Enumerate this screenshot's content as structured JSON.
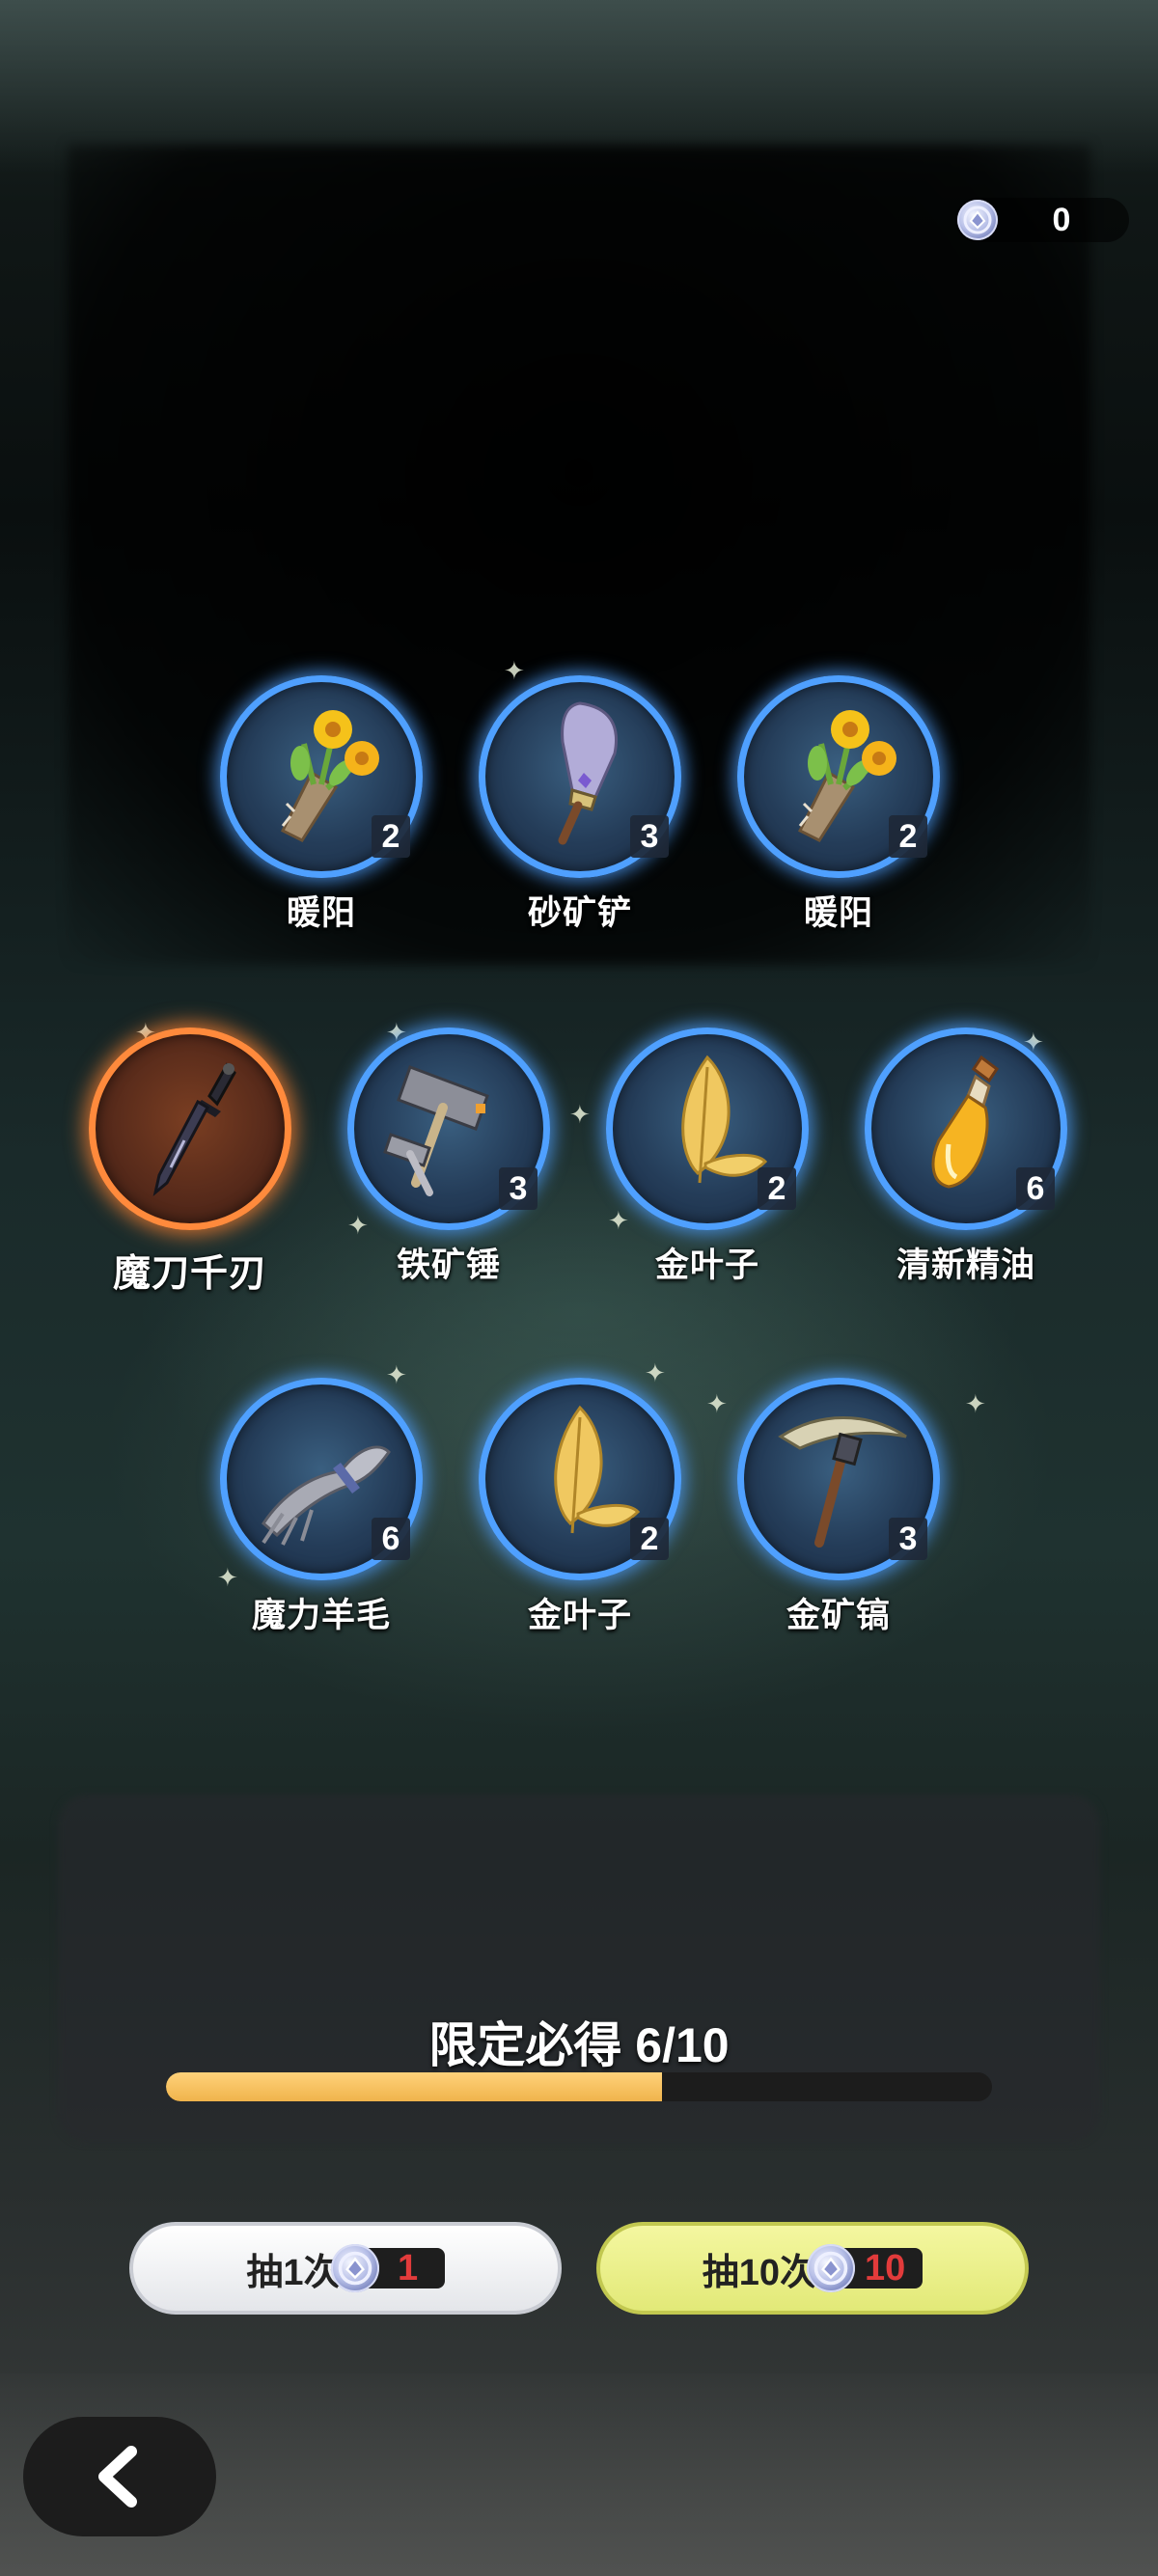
{
  "currency": {
    "amount": "0",
    "icon": "crystal-coin-icon"
  },
  "items": [
    {
      "name": "暖阳",
      "count": "2",
      "icon": "sunflower-bouquet-icon",
      "rarity": "blue"
    },
    {
      "name": "砂矿铲",
      "count": "3",
      "icon": "shovel-icon",
      "rarity": "blue"
    },
    {
      "name": "暖阳",
      "count": "2",
      "icon": "sunflower-bouquet-icon",
      "rarity": "blue"
    },
    {
      "name": "魔刀千刃",
      "count": "",
      "icon": "dagger-icon",
      "rarity": "orange"
    },
    {
      "name": "铁矿锤",
      "count": "3",
      "icon": "iron-hammer-icon",
      "rarity": "blue"
    },
    {
      "name": "金叶子",
      "count": "2",
      "icon": "golden-leaf-icon",
      "rarity": "blue"
    },
    {
      "name": "清新精油",
      "count": "6",
      "icon": "oil-bottle-icon",
      "rarity": "blue"
    },
    {
      "name": "魔力羊毛",
      "count": "6",
      "icon": "wool-bundle-icon",
      "rarity": "blue"
    },
    {
      "name": "金叶子",
      "count": "2",
      "icon": "golden-leaf-icon",
      "rarity": "blue"
    },
    {
      "name": "金矿镐",
      "count": "3",
      "icon": "pickaxe-icon",
      "rarity": "blue"
    }
  ],
  "progress": {
    "label": "限定必得 6/10",
    "current": 6,
    "total": 10
  },
  "buttons": {
    "draw_one": {
      "label": "抽1次",
      "cost": "1"
    },
    "draw_ten": {
      "label": "抽10次",
      "cost": "10"
    }
  },
  "back": {
    "icon": "chevron-left-icon"
  },
  "colors": {
    "blue_ring": "#4fa0ff",
    "orange_ring": "#ff8a3c",
    "progress_fill": "#f0b44c",
    "cost_text": "#e23b3b"
  }
}
